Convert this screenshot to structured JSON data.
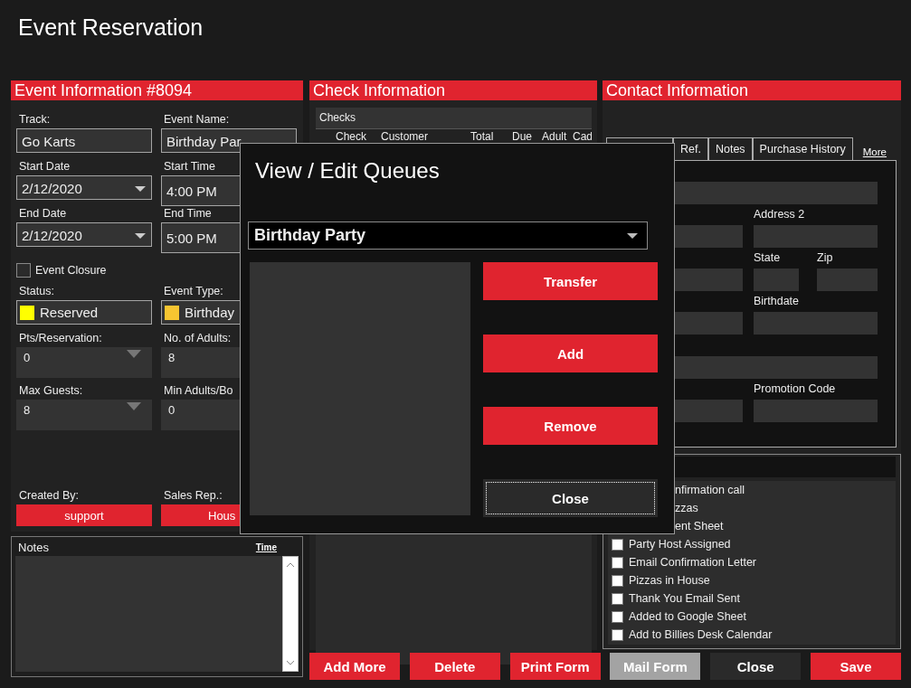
{
  "window": {
    "title": "Event Reservation"
  },
  "event_info": {
    "title": "Event Information #8094",
    "track": {
      "label": "Track:",
      "value": "Go Karts"
    },
    "event_name": {
      "label": "Event Name:",
      "value": "Birthday Par"
    },
    "start_date": {
      "label": "Start Date",
      "value": "2/12/2020"
    },
    "start_time": {
      "label": "Start Time",
      "value": "4:00 PM"
    },
    "end_date": {
      "label": "End Date",
      "value": "2/12/2020"
    },
    "end_time": {
      "label": "End Time",
      "value": "5:00 PM"
    },
    "event_closure": {
      "label": "Event Closure",
      "checked": false
    },
    "status": {
      "label": "Status:",
      "value": "Reserved",
      "color": "#ffff00"
    },
    "event_type": {
      "label": "Event Type:",
      "value": "Birthday",
      "color": "#f7c531"
    },
    "pts_reservation": {
      "label": "Pts/Reservation:",
      "value": "0"
    },
    "no_of_adults": {
      "label": "No. of Adults:",
      "value": "8"
    },
    "max_guests": {
      "label": "Max Guests:",
      "value": "8"
    },
    "min_adults": {
      "label": "Min Adults/Bo",
      "value": "0"
    },
    "created_by": {
      "label": "Created By:",
      "value": "support"
    },
    "sales_rep": {
      "label": "Sales Rep.:",
      "value": "Hous"
    }
  },
  "notes": {
    "label": "Notes",
    "time_link": "Time"
  },
  "check_info": {
    "title": "Check Information",
    "section": "Checks",
    "columns": [
      "Check",
      "Customer",
      "Total",
      "Due",
      "Adult",
      "Cad"
    ]
  },
  "contact_info": {
    "title": "Contact Information",
    "tabs": [
      "Ref.",
      "Notes",
      "Purchase History"
    ],
    "more_link": "More",
    "address2_label": "Address 2",
    "state_label": "State",
    "zip_label": "Zip",
    "birthdate_label": "Birthdate",
    "promotion_label": "Promotion Code"
  },
  "checklist": {
    "items": [
      {
        "label": "nfirmation call",
        "kind": "partial"
      },
      {
        "label": "zzas",
        "kind": "partial"
      },
      {
        "label": "ent Sheet",
        "kind": "partial"
      },
      {
        "label": "Party Host Assigned",
        "kind": "check",
        "checked": false
      },
      {
        "label": "Email Confirmation Letter",
        "kind": "check",
        "checked": false
      },
      {
        "label": "Pizzas in House",
        "kind": "check",
        "checked": false
      },
      {
        "label": "Thank You Email Sent",
        "kind": "check",
        "checked": false
      },
      {
        "label": "Added to Google Sheet",
        "kind": "check",
        "checked": false
      },
      {
        "label": "Add to Billies Desk Calendar",
        "kind": "check",
        "checked": false
      }
    ]
  },
  "actions": [
    {
      "label": "Add More",
      "kind": "primary"
    },
    {
      "label": "Delete",
      "kind": "primary"
    },
    {
      "label": "Print Form",
      "kind": "primary"
    },
    {
      "label": "Mail Form",
      "kind": "muted"
    },
    {
      "label": "Close",
      "kind": "dark"
    },
    {
      "label": "Save",
      "kind": "primary"
    }
  ],
  "queues_dialog": {
    "title": "View / Edit Queues",
    "queue": "Birthday Party",
    "buttons": [
      {
        "label": "Transfer",
        "kind": "primary"
      },
      {
        "label": "Add",
        "kind": "primary"
      },
      {
        "label": "Remove",
        "kind": "primary"
      },
      {
        "label": "Close",
        "kind": "focused"
      }
    ]
  }
}
